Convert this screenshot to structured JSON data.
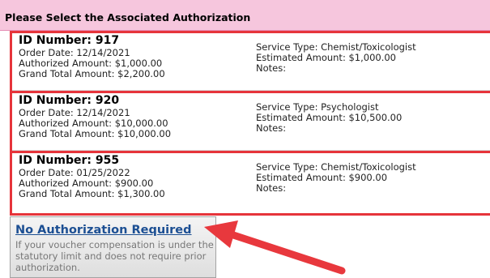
{
  "header": {
    "title": "Please Select the Associated Authorization"
  },
  "authorizations": [
    {
      "id_label": "ID Number: 917",
      "order_date": "Order Date: 12/14/2021",
      "authorized_amount": "Authorized Amount: $1,000.00",
      "grand_total": "Grand Total Amount: $2,200.00",
      "service_type": "Service Type: Chemist/Toxicologist",
      "estimated_amount": "Estimated Amount: $1,000.00",
      "notes": "Notes:"
    },
    {
      "id_label": "ID Number: 920",
      "order_date": "Order Date: 12/14/2021",
      "authorized_amount": "Authorized Amount: $10,000.00",
      "grand_total": "Grand Total Amount: $10,000.00",
      "service_type": "Service Type: Psychologist",
      "estimated_amount": "Estimated Amount: $10,500.00",
      "notes": "Notes:"
    },
    {
      "id_label": "ID Number: 955",
      "order_date": "Order Date: 01/25/2022",
      "authorized_amount": "Authorized Amount: $900.00",
      "grand_total": "Grand Total Amount: $1,300.00",
      "service_type": "Service Type: Chemist/Toxicologist",
      "estimated_amount": "Estimated Amount: $900.00",
      "notes": "Notes:"
    }
  ],
  "no_authorization": {
    "link_label": "No Authorization Required",
    "description": "If your voucher compensation is under the statutory limit and does not require prior authorization."
  },
  "colors": {
    "header_bg": "#f6c6dd",
    "highlight_border": "#e6343b",
    "link": "#1c4f93",
    "arrow": "#e8383d"
  },
  "annotation": {
    "icon": "red-arrow-icon"
  }
}
